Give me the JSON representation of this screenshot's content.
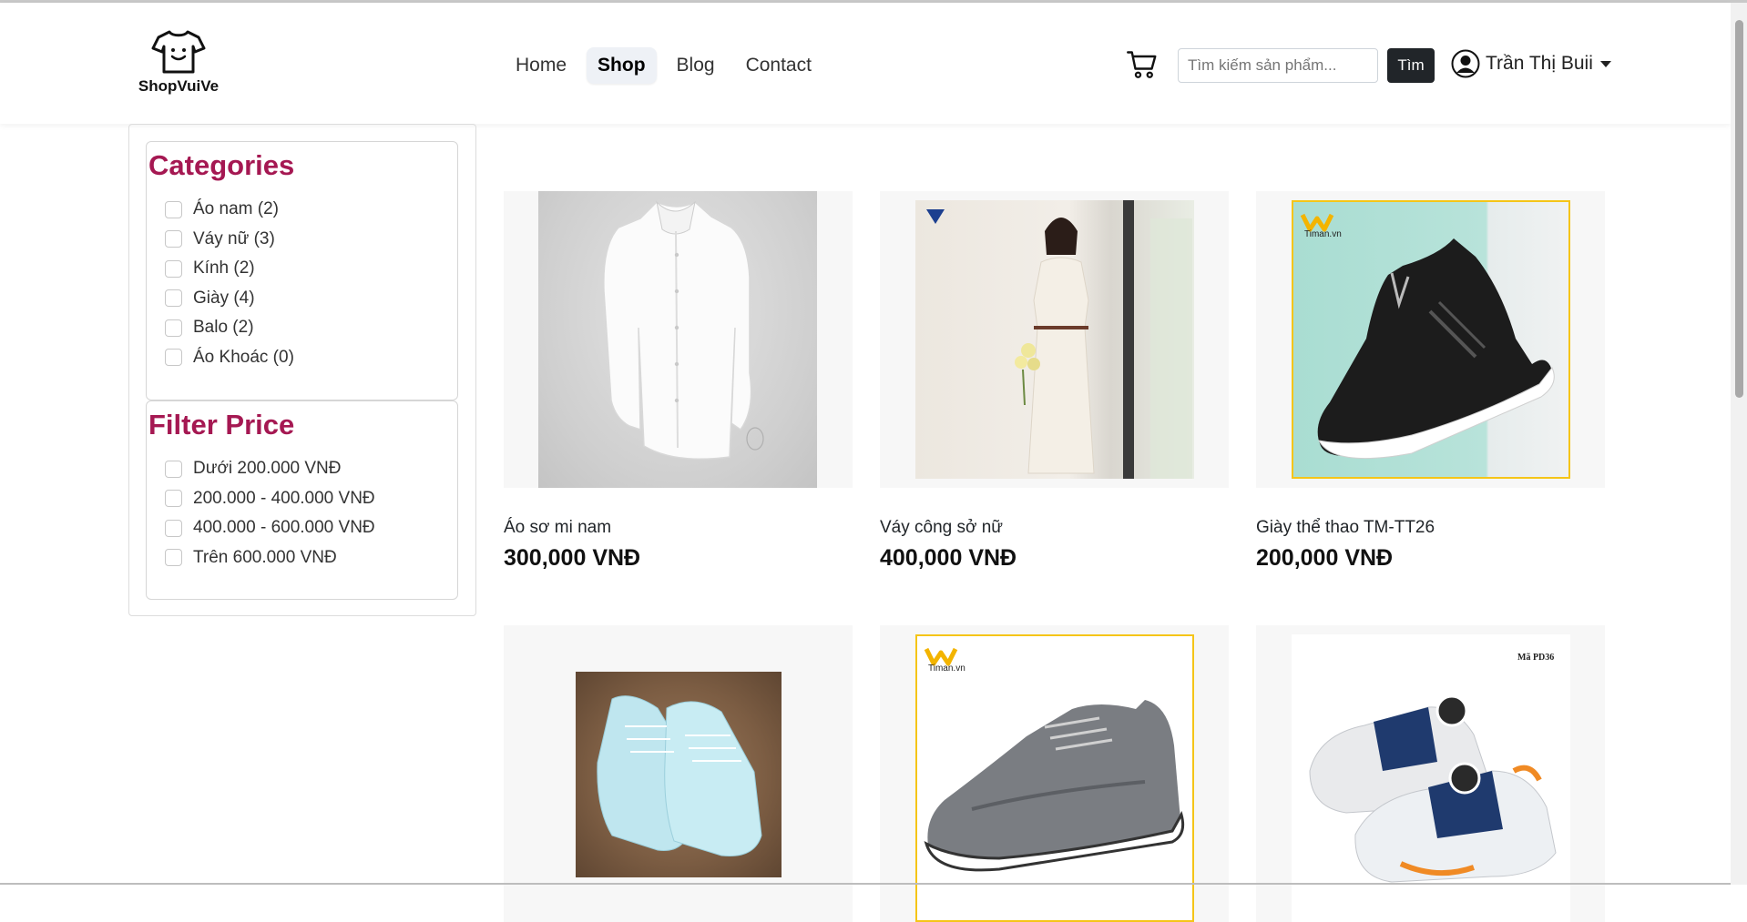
{
  "brand": {
    "name": "ShopVuiVe"
  },
  "nav": {
    "items": [
      {
        "label": "Home",
        "active": false
      },
      {
        "label": "Shop",
        "active": true
      },
      {
        "label": "Blog",
        "active": false
      },
      {
        "label": "Contact",
        "active": false
      }
    ]
  },
  "search": {
    "placeholder": "Tìm kiếm sản phẩm...",
    "button_label": "Tìm"
  },
  "user": {
    "name": "Trần Thị Buii"
  },
  "sidebar": {
    "categories_title": "Categories",
    "categories": [
      {
        "label": "Áo nam (2)"
      },
      {
        "label": "Váy nữ (3)"
      },
      {
        "label": "Kính (2)"
      },
      {
        "label": "Giày (4)"
      },
      {
        "label": "Balo (2)"
      },
      {
        "label": "Áo Khoác (0)"
      }
    ],
    "price_title": "Filter Price",
    "prices": [
      {
        "label": "Dưới 200.000 VNĐ"
      },
      {
        "label": "200.000 - 400.000 VNĐ"
      },
      {
        "label": "400.000 - 600.000 VNĐ"
      },
      {
        "label": "Trên 600.000 VNĐ"
      }
    ]
  },
  "products": [
    {
      "name": "Áo sơ mi nam",
      "price": "300,000 VNĐ",
      "image": "white-shirt"
    },
    {
      "name": "Váy công sở nữ",
      "price": "400,000 VNĐ",
      "image": "office-dress"
    },
    {
      "name": "Giày thể thao TM-TT26",
      "price": "200,000 VNĐ",
      "image": "black-sneaker"
    },
    {
      "name": "",
      "price": "",
      "image": "light-blue-sneakers"
    },
    {
      "name": "",
      "price": "",
      "image": "grey-sneaker"
    },
    {
      "name": "",
      "price": "",
      "image": "kids-sneakers"
    }
  ],
  "image_text": {
    "timan_1": "Timan.vn",
    "timan_2": "Timan.vn",
    "code": "Mã PD36"
  },
  "colors": {
    "accent": "#a51852",
    "dark_button": "#212529",
    "active_nav_bg": "#eef1f6"
  }
}
